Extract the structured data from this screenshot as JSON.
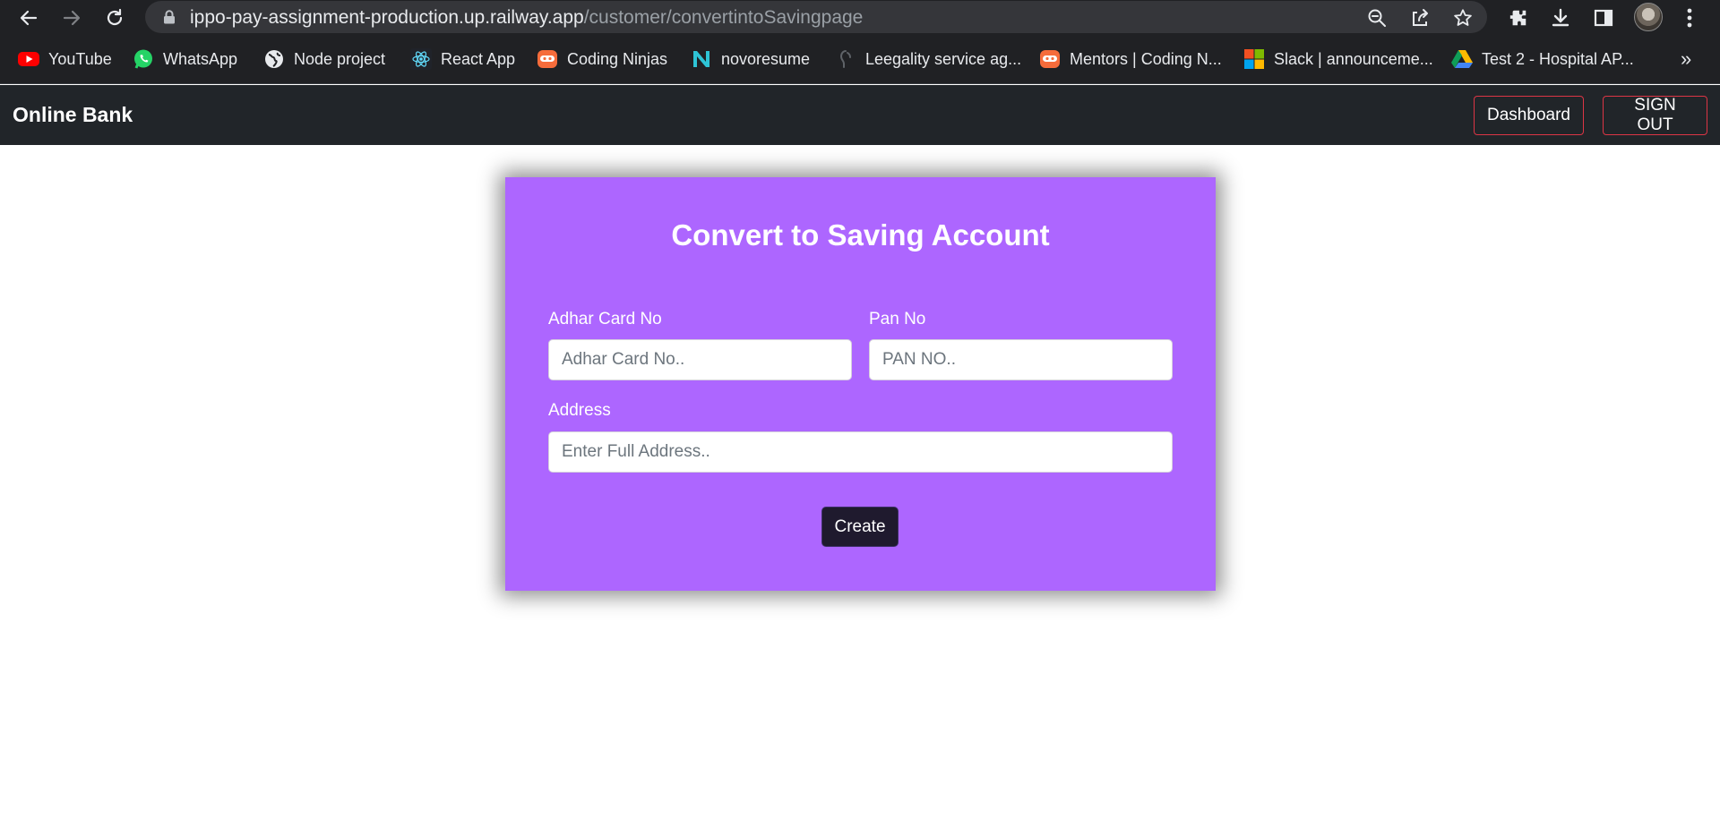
{
  "browser": {
    "url_host": "ippo-pay-assignment-production.up.railway.app",
    "url_path": "/customer/convertintoSavingpage",
    "bookmarks": [
      {
        "label": "YouTube",
        "icon": "youtube-icon"
      },
      {
        "label": "WhatsApp",
        "icon": "whatsapp-icon"
      },
      {
        "label": "Node project",
        "icon": "globe-icon"
      },
      {
        "label": "React App",
        "icon": "react-icon"
      },
      {
        "label": "Coding Ninjas",
        "icon": "coding-ninjas-icon"
      },
      {
        "label": "novoresume",
        "icon": "novoresume-icon"
      },
      {
        "label": "Leegality service ag...",
        "icon": "leegality-icon"
      },
      {
        "label": "Mentors | Coding N...",
        "icon": "coding-ninjas-icon"
      },
      {
        "label": "Slack | announceme...",
        "icon": "microsoft-icon"
      },
      {
        "label": "Test 2 - Hospital AP...",
        "icon": "google-drive-icon"
      }
    ],
    "more_bookmarks": "»"
  },
  "navbar": {
    "brand": "Online Bank",
    "dashboard_label": "Dashboard",
    "signout_label": "SIGN OUT",
    "accent_color": "#dc3545"
  },
  "form": {
    "title": "Convert to Saving Account",
    "card_color": "#ad66ff",
    "adhar": {
      "label": "Adhar Card No",
      "placeholder": "Adhar Card No..",
      "value": ""
    },
    "pan": {
      "label": "Pan No",
      "placeholder": "PAN NO..",
      "value": ""
    },
    "address": {
      "label": "Address",
      "placeholder": "Enter Full Address..",
      "value": ""
    },
    "submit_label": "Create"
  }
}
